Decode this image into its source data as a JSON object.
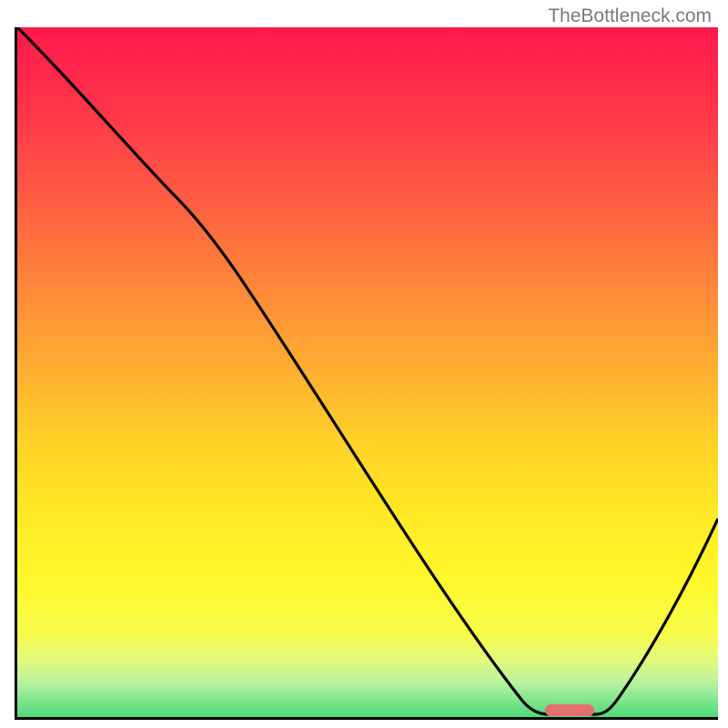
{
  "watermark": "TheBottleneck.com",
  "chart_data": {
    "type": "line",
    "title": "",
    "xlabel": "",
    "ylabel": "",
    "xlim": [
      0,
      100
    ],
    "ylim": [
      0,
      100
    ],
    "grid": false,
    "legend": null,
    "x": [
      0,
      22,
      75,
      82,
      100
    ],
    "values": [
      100,
      76,
      0,
      0,
      29
    ],
    "marker": {
      "shape": "rounded-rect",
      "x": 78.5,
      "y": 0.8,
      "width": 6,
      "height": 1.6,
      "color": "#e2706f"
    },
    "background_gradient": {
      "top": "#ff1a4d",
      "mid": "#ffd128",
      "bottom": "#4dd97a"
    }
  }
}
